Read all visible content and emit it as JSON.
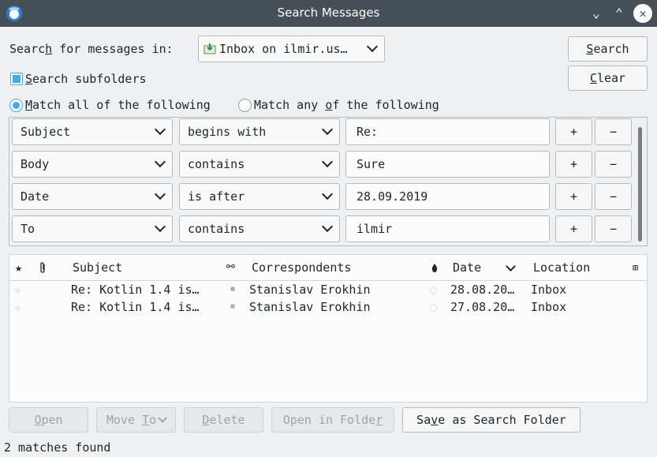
{
  "window": {
    "title": "Search Messages"
  },
  "search": {
    "label_pre": "Searc",
    "label_key": "h",
    "label_post": " for messages in:",
    "folder_value": "Inbox on ilmir.us…",
    "search_btn_key": "S",
    "search_btn_rest": "earch",
    "clear_btn_key": "C",
    "clear_btn_rest": "lear",
    "subfolders_key": "S",
    "subfolders_rest": "earch subfolders",
    "match_all_key": "M",
    "match_all_rest": "atch all of the following",
    "match_any_pre": "Match any ",
    "match_any_key": "o",
    "match_any_rest": "f the following"
  },
  "rules": [
    {
      "field": "Subject",
      "op": "begins with",
      "value": "Re:"
    },
    {
      "field": "Body",
      "op": "contains",
      "value": "Sure"
    },
    {
      "field": "Date",
      "op": "is after",
      "value": "28.09.2019"
    },
    {
      "field": "To",
      "op": "contains",
      "value": "ilmir"
    }
  ],
  "rule_buttons": {
    "add": "+",
    "remove": "−"
  },
  "columns": {
    "subject": "Subject",
    "correspondents": "Correspondents",
    "date": "Date",
    "location": "Location"
  },
  "messages": [
    {
      "subject": "Re: Kotlin 1.4 is…",
      "correspondent": "Stanislav Erokhin",
      "date": "28.08.20…",
      "location": "Inbox"
    },
    {
      "subject": "Re: Kotlin 1.4 is…",
      "correspondent": "Stanislav Erokhin",
      "date": "27.08.20…",
      "location": "Inbox"
    }
  ],
  "actions": {
    "open_pre": "",
    "open_key": "O",
    "open_rest": "pen",
    "move_pre": "Move ",
    "move_key": "T",
    "move_rest": "o",
    "delete_pre": "",
    "delete_key": "D",
    "delete_rest": "elete",
    "openfolder_pre": "Open in Folde",
    "openfolder_key": "r",
    "openfolder_rest": "",
    "save_pre": "Sa",
    "save_key": "v",
    "save_rest": "e as Search Folder"
  },
  "status": {
    "text": "2 matches found"
  },
  "colors": {
    "accent": "#3daee9",
    "titlebar": "#475057"
  }
}
